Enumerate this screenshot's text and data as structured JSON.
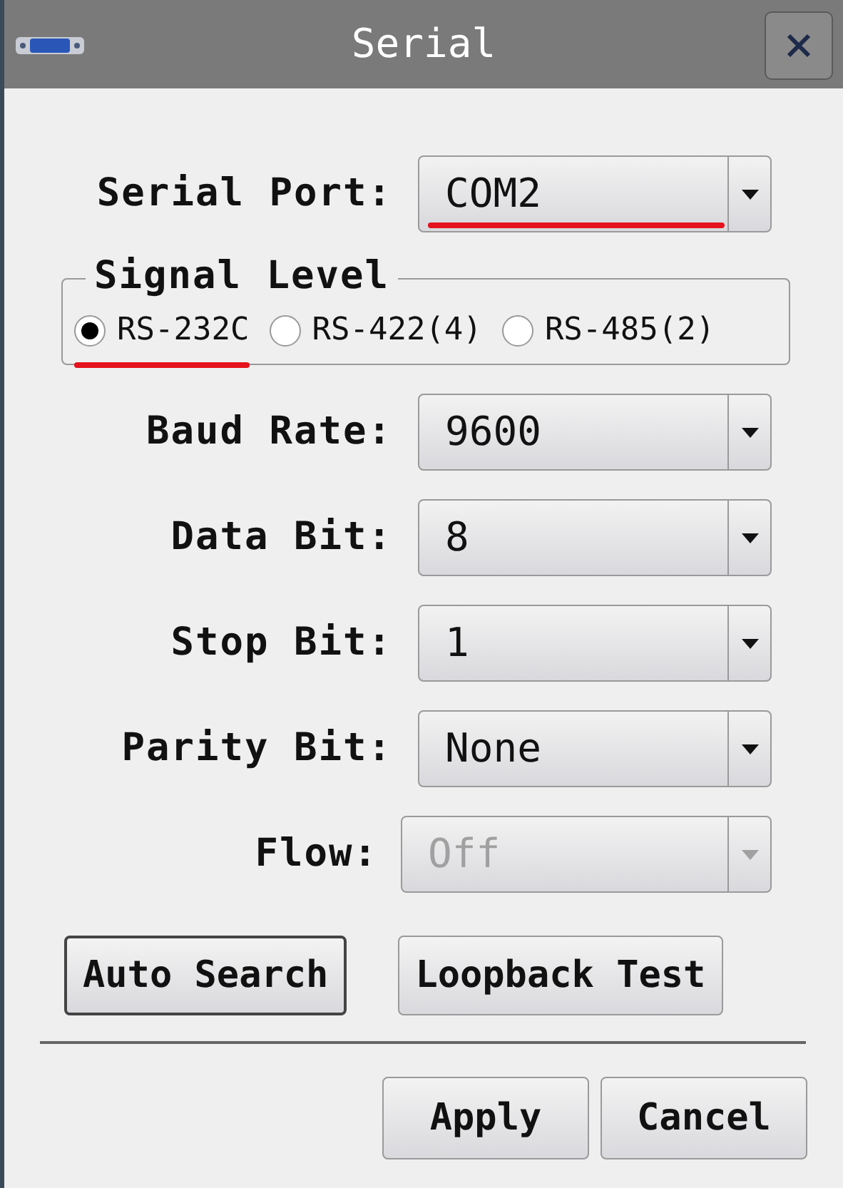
{
  "window": {
    "title": "Serial"
  },
  "serial_port": {
    "label": "Serial Port:",
    "value": "COM2",
    "highlighted": true
  },
  "signal_level": {
    "title": "Signal Level",
    "options": [
      {
        "label": "RS-232C",
        "selected": true,
        "highlighted": true
      },
      {
        "label": "RS-422(4)",
        "selected": false,
        "highlighted": false
      },
      {
        "label": "RS-485(2)",
        "selected": false,
        "highlighted": false
      }
    ]
  },
  "fields": [
    {
      "label": "Baud Rate:",
      "value": "9600",
      "disabled": false
    },
    {
      "label": "Data Bit:",
      "value": "8",
      "disabled": false
    },
    {
      "label": "Stop Bit:",
      "value": "1",
      "disabled": false
    },
    {
      "label": "Parity Bit:",
      "value": "None",
      "disabled": false
    },
    {
      "label": "Flow:",
      "value": "Off",
      "disabled": true
    }
  ],
  "action_buttons": [
    {
      "label": "Auto Search",
      "default": true
    },
    {
      "label": "Loopback Test",
      "default": false
    }
  ],
  "footer_buttons": [
    "Apply",
    "Cancel"
  ]
}
